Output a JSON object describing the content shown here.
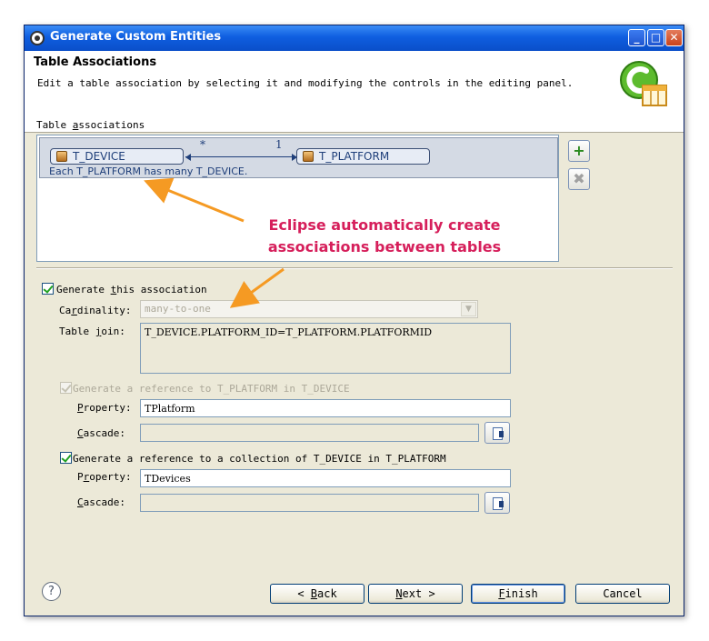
{
  "window": {
    "title": "Generate Custom Entities",
    "controls": {
      "minimize": "_",
      "maximize": "□",
      "close": "✕"
    }
  },
  "header": {
    "title": "Table Associations",
    "description": "Edit a table association by selecting it and modifying the controls in the editing panel."
  },
  "associations": {
    "label_pre": "Table ",
    "label_mnemonic": "a",
    "label_post": "ssociations",
    "rows": [
      {
        "source": "T_DEVICE",
        "target": "T_PLATFORM",
        "source_cardinality": "*",
        "target_cardinality": "1",
        "description": "Each T_PLATFORM has many T_DEVICE."
      }
    ],
    "add_button": "+",
    "remove_button": "✖"
  },
  "annotation": {
    "line1": "Eclipse automatically create",
    "line2": "associations between tables",
    "color": "#d61f5b"
  },
  "editor": {
    "generate_association": {
      "checked": true,
      "label_pre": "Generate ",
      "label_mnemonic": "t",
      "label_post": "his association"
    },
    "cardinality": {
      "label_pre": "Ca",
      "label_mnemonic": "r",
      "label_post": "dinality:",
      "value": "many-to-one",
      "enabled": false
    },
    "table_join": {
      "label_pre": "Table ",
      "label_mnemonic": "j",
      "label_post": "oin:",
      "value": "T_DEVICE.PLATFORM_ID=T_PLATFORM.PLATFORMID"
    },
    "ref_to_one": {
      "checked": true,
      "enabled": false,
      "label": "Generate a reference to T_PLATFORM in T_DEVICE",
      "property_label_mnemonic": "P",
      "property_label_post": "roperty:",
      "property_value": "TPlatform",
      "cascade_label_mnemonic": "C",
      "cascade_label_post": "ascade:",
      "cascade_value": ""
    },
    "ref_to_many": {
      "checked": true,
      "enabled": true,
      "label": "Generate a reference to a collection of T_DEVICE in T_PLATFORM",
      "property_label_pre": "P",
      "property_label_mnemonic": "r",
      "property_label_post": "operty:",
      "property_value": "TDevices",
      "cascade_label_mnemonic": "C",
      "cascade_label_post": "ascade:",
      "cascade_value": ""
    }
  },
  "footer": {
    "help": "?",
    "back_pre": "< ",
    "back_mnemonic": "B",
    "back_post": "ack",
    "next_mnemonic": "N",
    "next_post": "ext >",
    "finish_mnemonic": "F",
    "finish_post": "inish",
    "cancel": "Cancel"
  }
}
